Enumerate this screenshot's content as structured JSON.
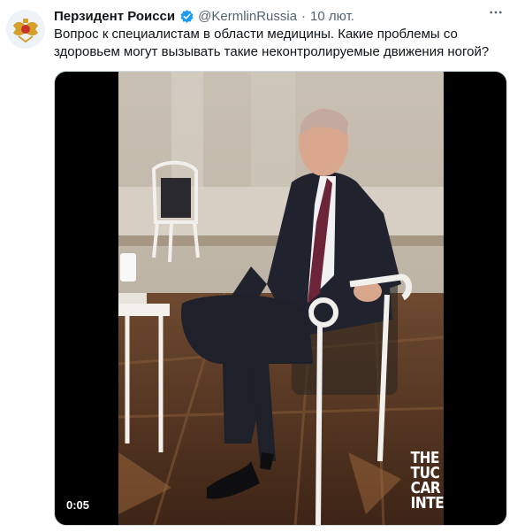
{
  "tweet": {
    "author_name": "Перзидент Роисси",
    "handle": "@KermlinRussia",
    "separator": "·",
    "time": "10 лют.",
    "text": "Вопрос к специалистам в области медицины. Какие проблемы со здоровьем могут вызывать такие неконтролируемые движения ногой?",
    "verified_icon": "verified-badge-icon",
    "more_icon": "more-icon",
    "avatar_icon": "coat-of-arms-icon"
  },
  "video": {
    "duration": "0:05",
    "watermark_lines": [
      "THE",
      "TUC",
      "CAR",
      "INTE"
    ]
  },
  "colors": {
    "text_primary": "#0f1419",
    "text_secondary": "#536471",
    "verified_blue": "#1d9bf0",
    "media_background": "#000000"
  }
}
